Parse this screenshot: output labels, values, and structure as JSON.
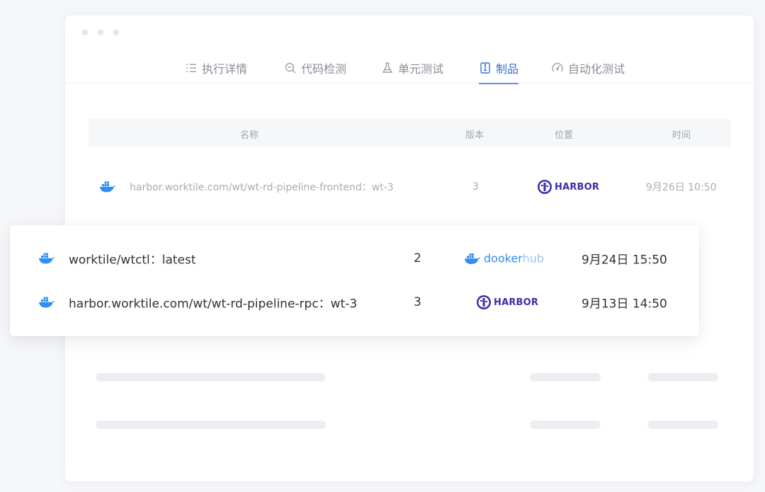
{
  "tabs": [
    {
      "label": "执行详情",
      "icon": "list-icon"
    },
    {
      "label": "代码检测",
      "icon": "search-icon"
    },
    {
      "label": "单元测试",
      "icon": "flask-icon"
    },
    {
      "label": "制品",
      "icon": "artifact-icon",
      "active": true
    },
    {
      "label": "自动化测试",
      "icon": "gauge-icon"
    }
  ],
  "table": {
    "headers": [
      "名称",
      "版本",
      "位置",
      "时间"
    ],
    "rows": [
      {
        "name": "harbor.worktile.com/wt/wt-rd-pipeline-frontend：wt-3",
        "version": "3",
        "location": "HARBOR",
        "time": "9月26日 10:50"
      }
    ]
  },
  "card": {
    "rows": [
      {
        "name": "worktile/wtctl：latest",
        "version": "2",
        "location_part1": "dooker",
        "location_part2": "hub",
        "time": "9月24日 15:50"
      },
      {
        "name": "harbor.worktile.com/wt/wt-rd-pipeline-rpc：wt-3",
        "version": "3",
        "location": "HARBOR",
        "time": "9月13日 14:50"
      }
    ]
  },
  "colors": {
    "accent": "#3b6fd6",
    "harbor": "#3b2fa8",
    "docker": "#2f8ef0"
  }
}
